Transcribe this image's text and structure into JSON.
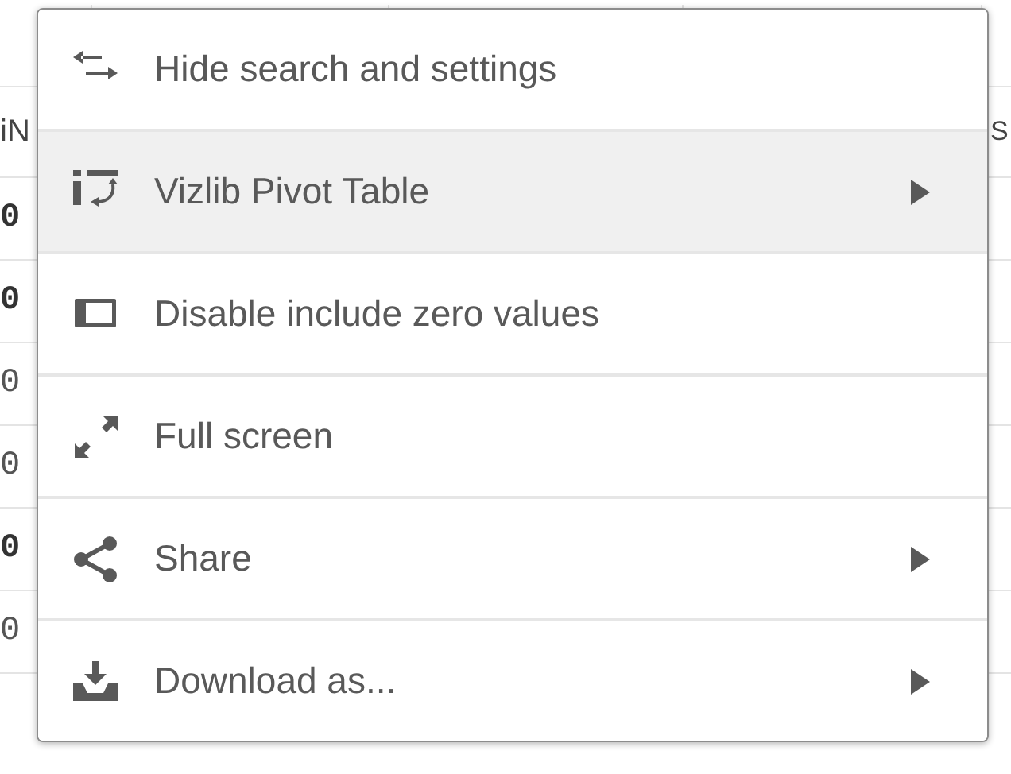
{
  "table": {
    "header": {
      "column_1": "iN",
      "column_5": "S"
    },
    "rows": [
      {
        "column_1": "0",
        "bold": true
      },
      {
        "column_1": "0",
        "bold": true
      },
      {
        "column_1": "0",
        "bold": false
      },
      {
        "column_1": "0",
        "bold": false
      },
      {
        "column_1": "0",
        "bold": true
      },
      {
        "column_1": "0",
        "bold": false
      }
    ]
  },
  "menu": {
    "items": [
      {
        "kind": "arrows",
        "label": "Hide search and settings",
        "selected": false,
        "submenu": false
      },
      {
        "kind": "pivot",
        "label": "Vizlib Pivot Table",
        "selected": true,
        "submenu": true
      },
      {
        "kind": "panel",
        "label": "Disable include zero values",
        "selected": false,
        "submenu": false
      },
      {
        "kind": "expand",
        "label": "Full screen",
        "selected": false,
        "submenu": false
      },
      {
        "kind": "share",
        "label": "Share",
        "selected": false,
        "submenu": true
      },
      {
        "kind": "download",
        "label": "Download as...",
        "selected": false,
        "submenu": true
      }
    ]
  }
}
